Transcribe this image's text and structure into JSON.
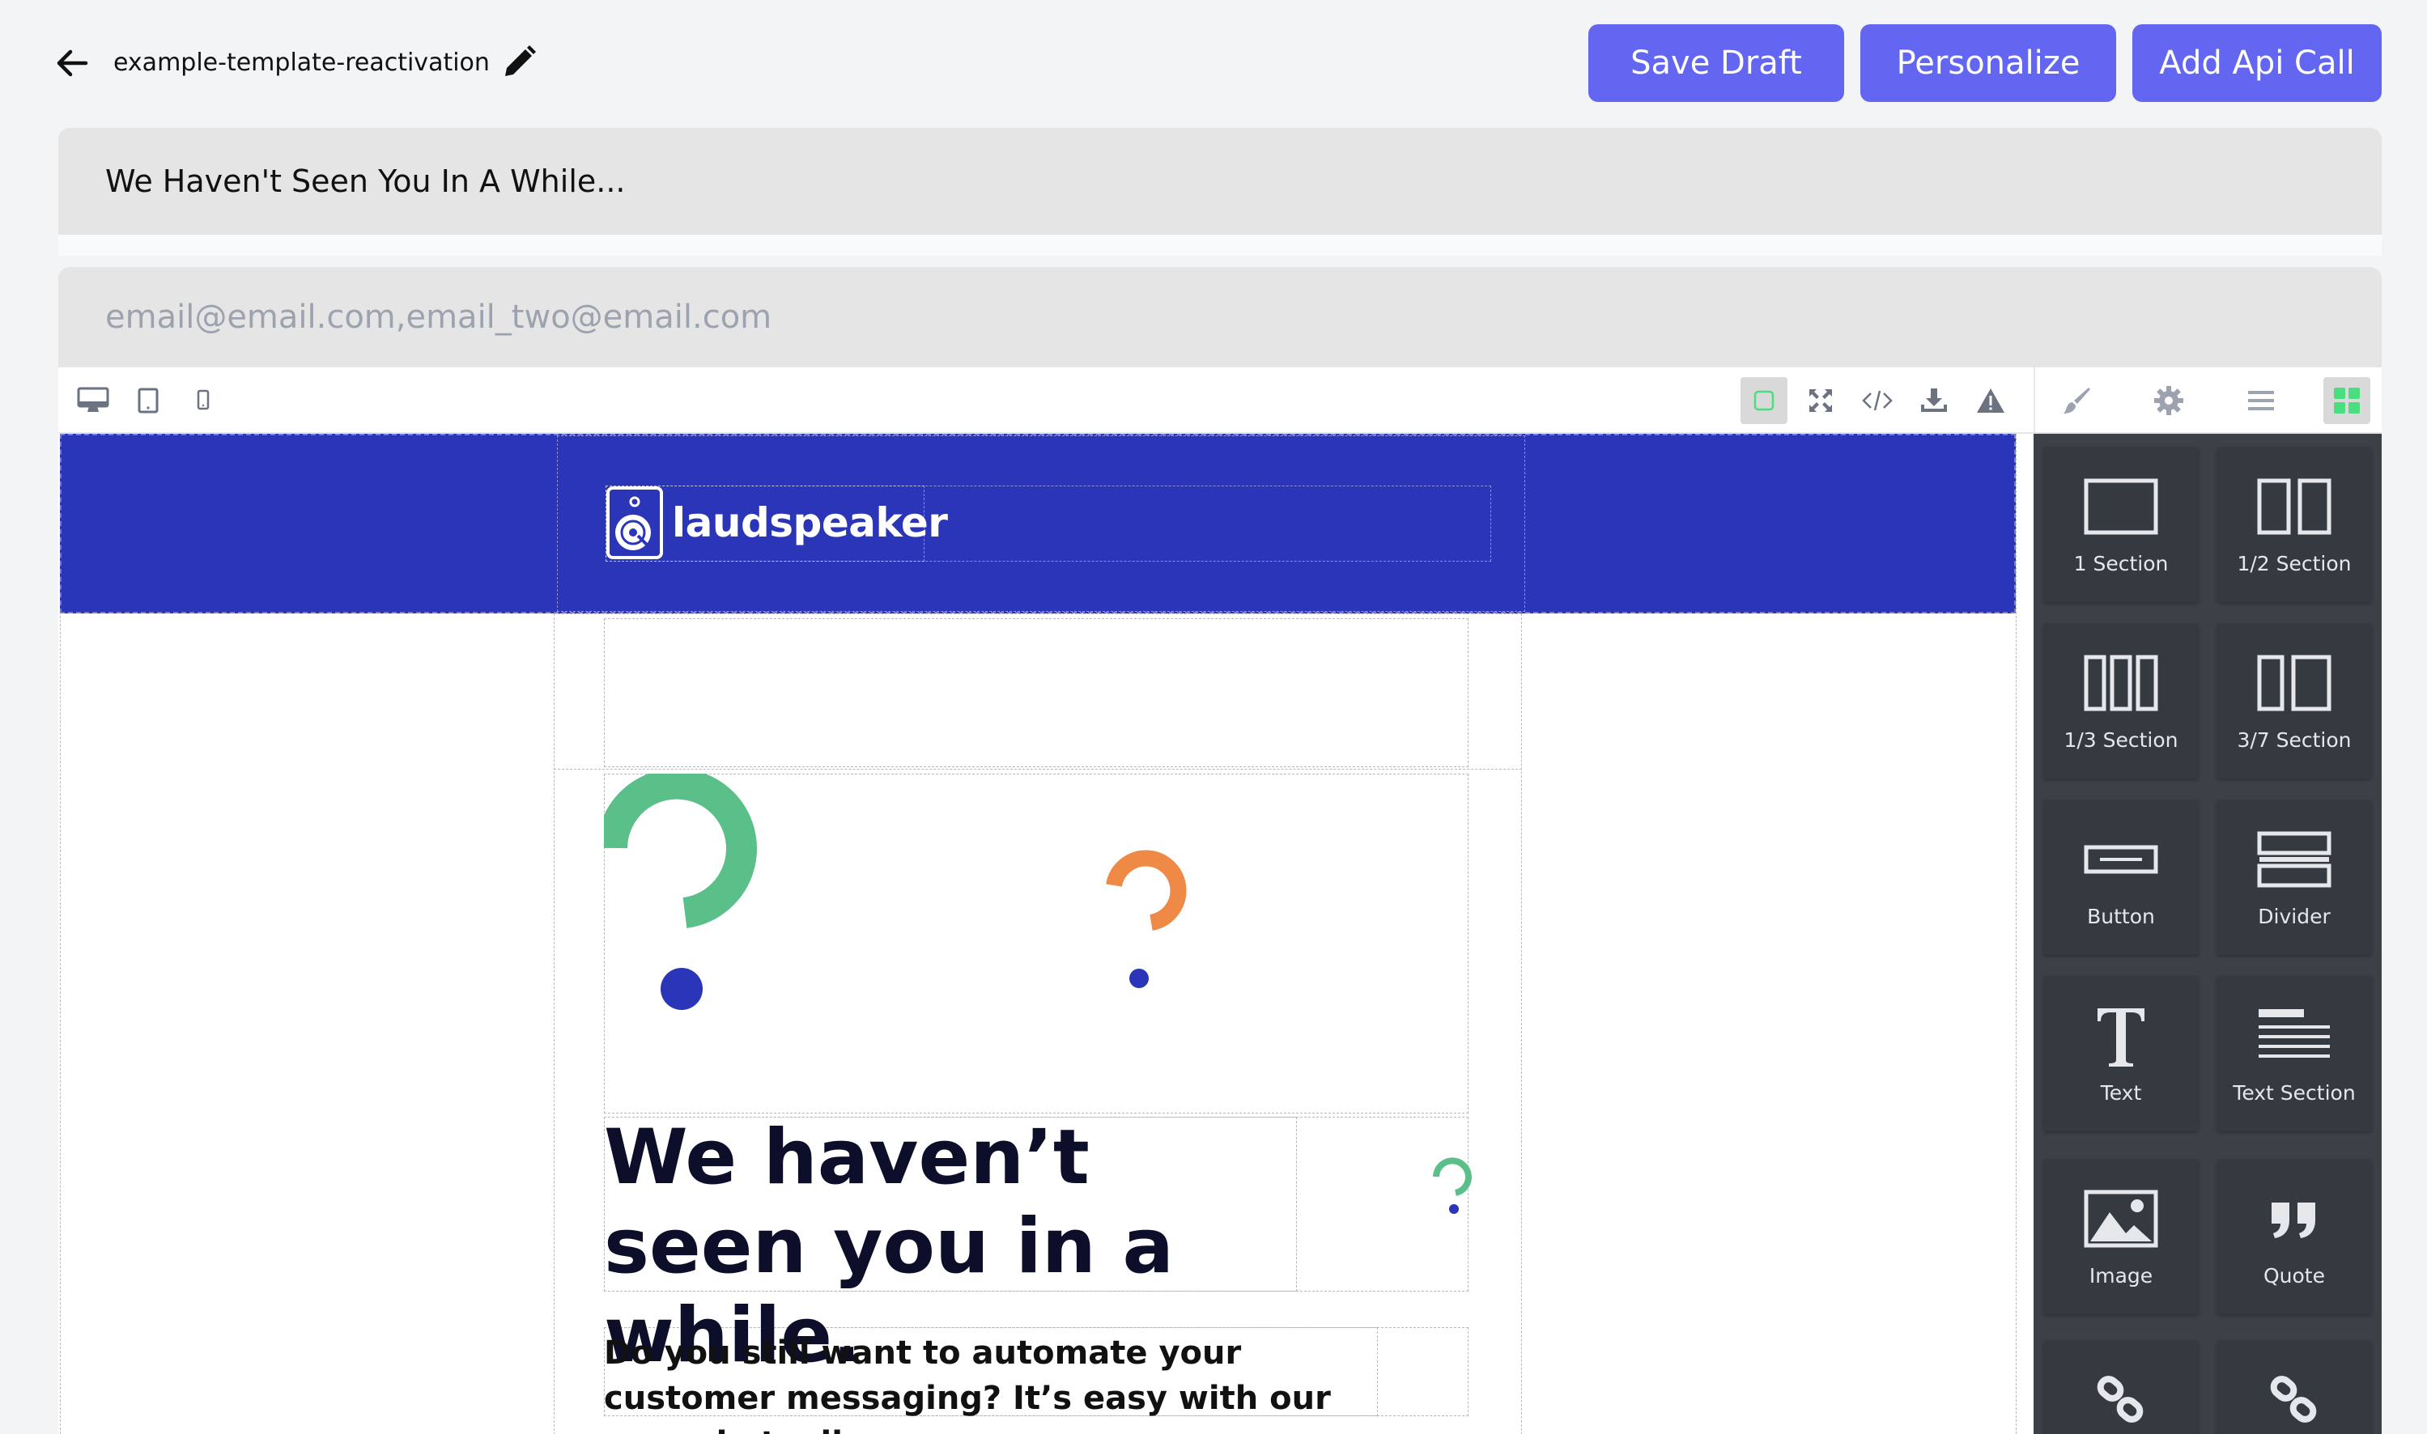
{
  "header": {
    "template_name": "example-template-reactivation",
    "buttons": {
      "save_draft": "Save Draft",
      "personalize": "Personalize",
      "add_api_call": "Add Api Call"
    },
    "accent_color": "#6366f1"
  },
  "subject": {
    "value": "We Haven't Seen You In A While..."
  },
  "recipients": {
    "placeholder": "email@email.com,email_two@email.com"
  },
  "editor": {
    "device_tools": [
      "desktop-icon",
      "tablet-icon",
      "mobile-icon"
    ],
    "action_tools": [
      "component-outline-icon",
      "fullscreen-icon",
      "code-icon",
      "import-icon",
      "warning-icon"
    ],
    "panel_tabs": [
      "style-manager-icon",
      "settings-icon",
      "layers-icon",
      "blocks-icon"
    ],
    "blocks": [
      {
        "label": "1 Section",
        "icon": "section-1-icon"
      },
      {
        "label": "1/2 Section",
        "icon": "section-half-icon"
      },
      {
        "label": "1/3 Section",
        "icon": "section-third-icon"
      },
      {
        "label": "3/7 Section",
        "icon": "section-3-7-icon"
      },
      {
        "label": "Button",
        "icon": "button-block-icon"
      },
      {
        "label": "Divider",
        "icon": "divider-block-icon"
      },
      {
        "label": "Text",
        "icon": "text-block-icon"
      },
      {
        "label": "Text Section",
        "icon": "text-section-icon"
      },
      {
        "label": "Image",
        "icon": "image-block-icon"
      },
      {
        "label": "Quote",
        "icon": "quote-block-icon"
      }
    ],
    "banner_color": "#2b35b8"
  },
  "email": {
    "logo_text": "laudspeaker",
    "headline": "We haven’t seen you in a while.",
    "body": "Do you still want to automate your customer messaging? It’s easy with our no-code tooling.."
  }
}
